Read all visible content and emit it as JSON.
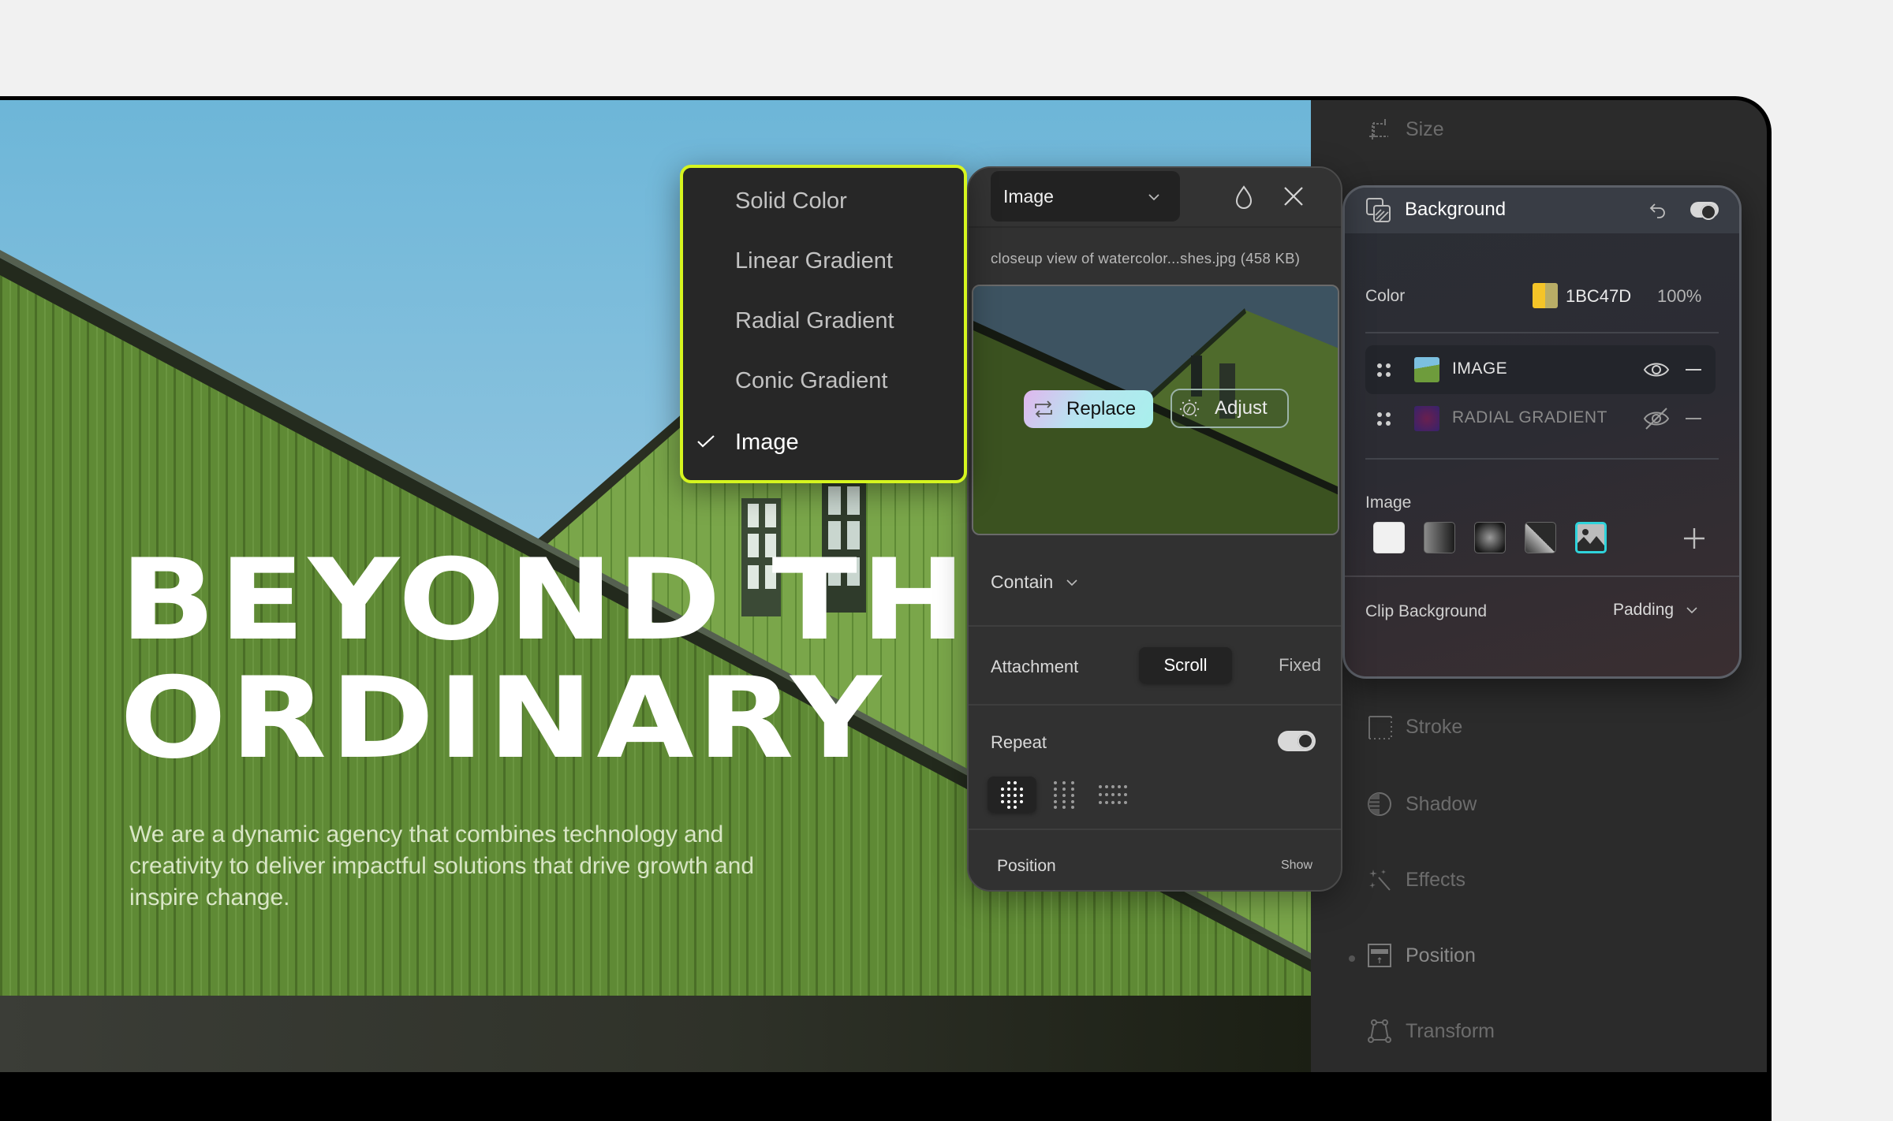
{
  "canvas": {
    "headline_line1": "BEYOND TH",
    "headline_line2": "ORDINARY",
    "body_text": "We are a dynamic agency that combines technology and creativity to deliver impactful solutions that drive growth and inspire change."
  },
  "sidebar": {
    "items": [
      {
        "label": "Size",
        "icon": "crop-icon"
      },
      {
        "label": "Stroke",
        "icon": "stroke-icon"
      },
      {
        "label": "Shadow",
        "icon": "shadow-icon"
      },
      {
        "label": "Effects",
        "icon": "magic-wand-icon"
      },
      {
        "label": "Position",
        "icon": "position-icon",
        "modified": true
      },
      {
        "label": "Transform",
        "icon": "transform-icon"
      }
    ]
  },
  "fill_type_menu": {
    "options": [
      "Solid Color",
      "Linear Gradient",
      "Radial Gradient",
      "Conic Gradient",
      "Image"
    ],
    "selected": "Image",
    "accent_color": "#d6f51f"
  },
  "fill_editor": {
    "type_value": "Image",
    "file_name": "closeup view of watercolor...shes.jpg (458 KB)",
    "replace_label": "Replace",
    "adjust_label": "Adjust",
    "size_mode": "Contain",
    "attachment_label": "Attachment",
    "attachment_options": [
      "Scroll",
      "Fixed"
    ],
    "attachment_selected": "Scroll",
    "repeat_label": "Repeat",
    "repeat_enabled": true,
    "repeat_modes": [
      "repeat-both",
      "repeat-x",
      "repeat-y"
    ],
    "repeat_selected": "repeat-both",
    "position_label": "Position",
    "position_action": "Show"
  },
  "background_panel": {
    "title": "Background",
    "enabled": true,
    "color_label": "Color",
    "color_hex": "1BC47D",
    "color_opacity": "100%",
    "layers": [
      {
        "name": "IMAGE",
        "visible": true,
        "active": true
      },
      {
        "name": "RADIAL GRADIENT",
        "visible": false,
        "active": false
      }
    ],
    "image_label": "Image",
    "fill_types": [
      "solid",
      "linear",
      "radial",
      "conic",
      "image"
    ],
    "fill_type_selected": "image",
    "selected_color": "#2fd3db",
    "clip_label": "Clip Background",
    "clip_value": "Padding"
  }
}
